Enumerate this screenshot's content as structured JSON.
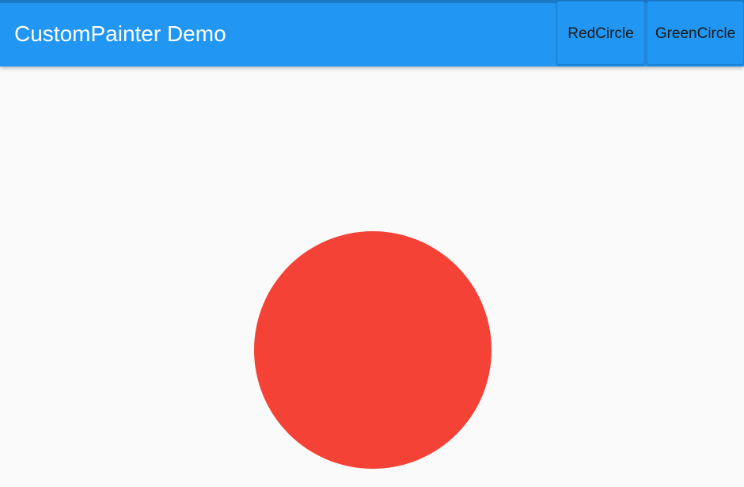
{
  "app": {
    "title": "CustomPainter Demo",
    "appbar_color": "#2196f3"
  },
  "actions": {
    "red_circle_label": "RedCircle",
    "green_circle_label": "GreenCircle"
  },
  "canvas": {
    "shape": "circle",
    "selected_color_name": "red",
    "circle_color": "#f44336",
    "background_color": "#fafafa"
  }
}
